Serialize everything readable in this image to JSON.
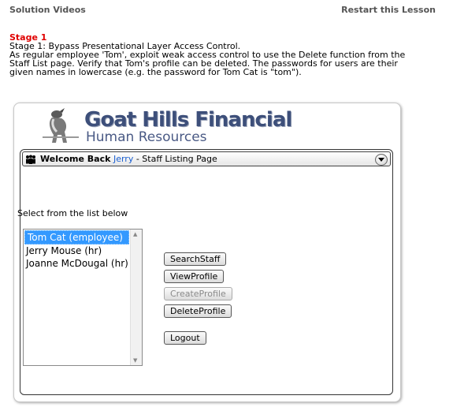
{
  "header": {
    "solution_videos": "Solution Videos",
    "restart_lesson": "Restart this Lesson"
  },
  "lesson": {
    "stage_title": "Stage 1",
    "description_lines": [
      "Stage 1: Bypass Presentational Layer Access Control.",
      "As regular employee 'Tom', exploit weak access control to use the Delete function from the",
      "Staff List page. Verify that Tom's profile can be deleted. The passwords for users are their",
      "given names in lowercase (e.g. the password for Tom Cat is \"tom\")."
    ]
  },
  "app": {
    "logo_title": "Goat Hills Financial",
    "logo_subtitle": "Human Resources",
    "welcome_prefix": "Welcome Back",
    "username": "Jerry",
    "welcome_suffix": " - Staff Listing Page",
    "select_label": "Select from the list below",
    "staff_list": [
      {
        "label": "Tom Cat (employee)",
        "selected": true
      },
      {
        "label": "Jerry Mouse (hr)",
        "selected": false
      },
      {
        "label": "Joanne McDougal (hr)",
        "selected": false
      }
    ],
    "buttons": {
      "search_staff": "SearchStaff",
      "view_profile": "ViewProfile",
      "create_profile": "CreateProfile",
      "delete_profile": "DeleteProfile",
      "logout": "Logout"
    }
  },
  "colors": {
    "stage_title": "#e00000",
    "username_link": "#1a5fd1",
    "selected_item": "#3399ff",
    "logo_text": "#3d4f7a"
  }
}
